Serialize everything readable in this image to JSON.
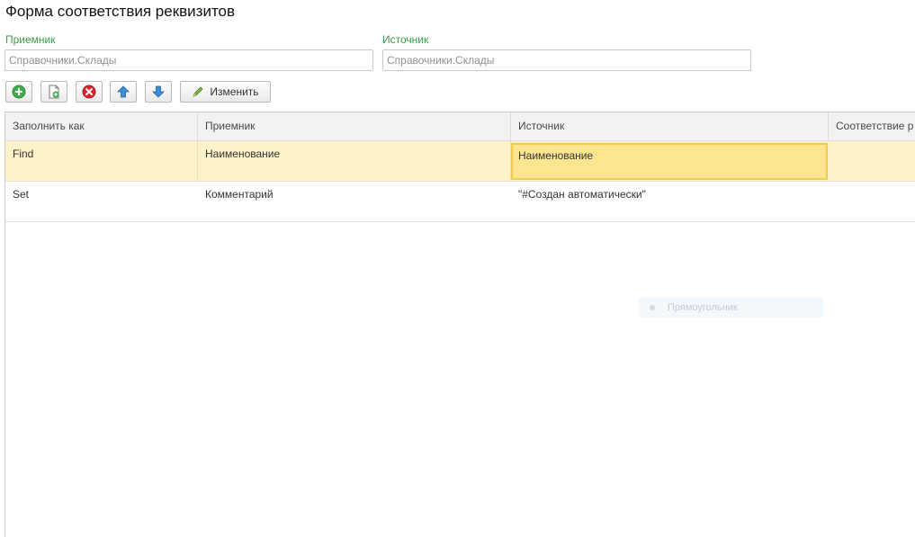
{
  "form": {
    "title": "Форма соответствия реквизитов"
  },
  "fields": {
    "receiver": {
      "label": "Приемник",
      "placeholder": "Справочники.Склады"
    },
    "source": {
      "label": "Источник",
      "placeholder": "Справочники.Склады"
    }
  },
  "toolbar": {
    "add_icon": "add-icon",
    "copy_icon": "copy-icon",
    "delete_icon": "delete-icon",
    "move_up_icon": "arrow-up-icon",
    "move_down_icon": "arrow-down-icon",
    "edit_label": "Изменить"
  },
  "table": {
    "columns": [
      "Заполнить как",
      "Приемник",
      "Источник",
      "Соответствие р"
    ],
    "rows": [
      {
        "fill_as": "Find",
        "receiver": "Наименование",
        "source": "Наименование",
        "mapping": ""
      },
      {
        "fill_as": "Set",
        "receiver": "Комментарий",
        "source": "\"#Создан автоматически\"",
        "mapping": ""
      }
    ]
  },
  "tooltip": {
    "text": "Прямоугольник"
  },
  "colors": {
    "label_green": "#3d9c4a",
    "selected_row": "#fdf2c8",
    "active_cell": "#fde68f",
    "active_cell_border": "#f1cb4b"
  }
}
